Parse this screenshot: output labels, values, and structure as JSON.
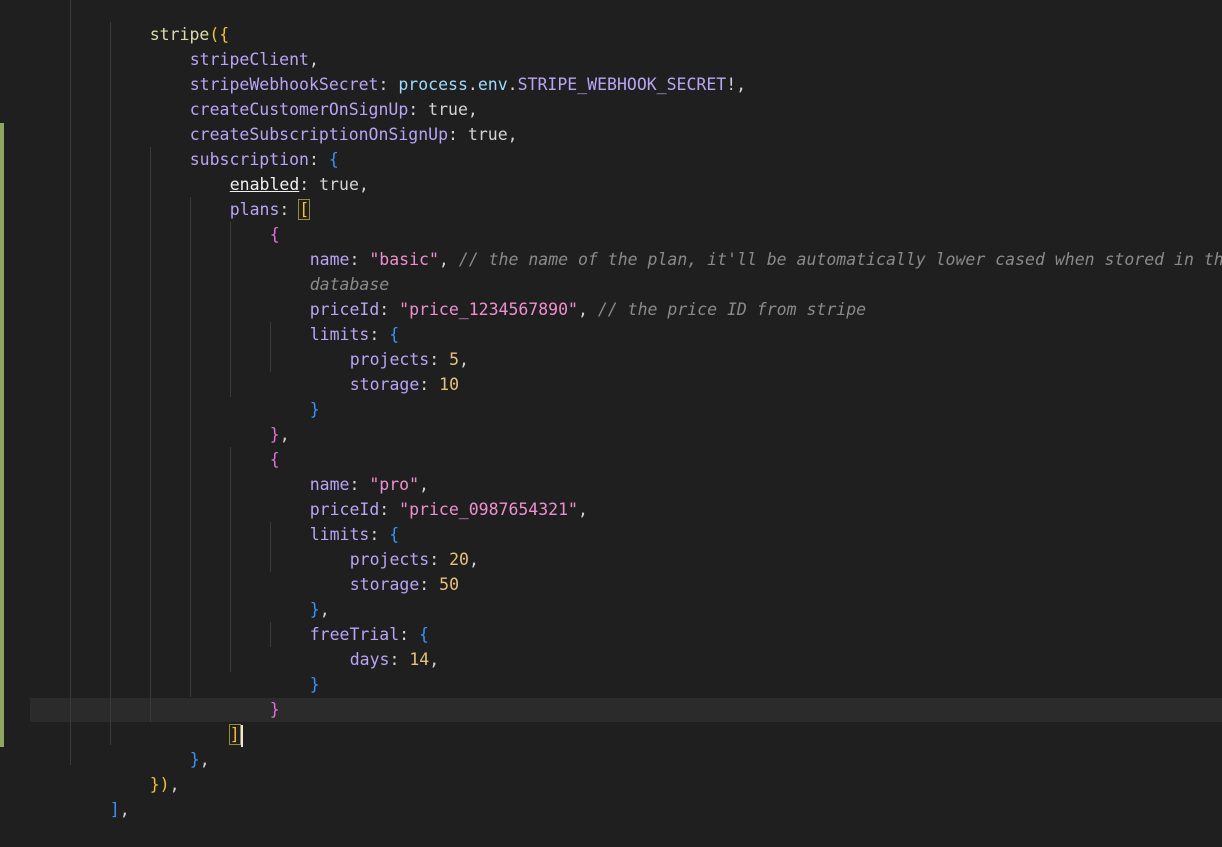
{
  "editor": {
    "lines": {
      "l1": {
        "fn": "stripe",
        "open": "({"
      },
      "l2": {
        "prop": "stripeClient",
        "tail": ","
      },
      "l3": {
        "prop": "stripeWebhookSecret",
        "colon": ": ",
        "obj": "process",
        "dot": ".",
        "env": "env",
        "dot2": ".",
        "const": "STRIPE_WEBHOOK_SECRET",
        "tail": "!,"
      },
      "l4": {
        "prop": "createCustomerOnSignUp",
        "colon": ": ",
        "val": "true",
        "tail": ","
      },
      "l5": {
        "prop": "createSubscriptionOnSignUp",
        "colon": ": ",
        "val": "true",
        "tail": ","
      },
      "l6": {
        "prop": "subscription",
        "colon": ": ",
        "open": "{"
      },
      "l7": {
        "prop": "enabled",
        "colon": ": ",
        "val": "true",
        "tail": ","
      },
      "l8": {
        "prop": "plans",
        "colon": ": ",
        "open": "["
      },
      "l9": {
        "open": "{"
      },
      "l10": {
        "prop": "name",
        "colon": ": ",
        "str": "\"basic\"",
        "tail": ", ",
        "cmt": "// the name of the plan, it'll be automatically lower cased when stored in the"
      },
      "l11": {
        "cmt": "database"
      },
      "l12": {
        "prop": "priceId",
        "colon": ": ",
        "str": "\"price_1234567890\"",
        "tail": ", ",
        "cmt": "// the price ID from stripe"
      },
      "l13": {
        "prop": "limits",
        "colon": ": ",
        "open": "{"
      },
      "l14": {
        "prop": "projects",
        "colon": ": ",
        "num": "5",
        "tail": ","
      },
      "l15": {
        "prop": "storage",
        "colon": ": ",
        "num": "10"
      },
      "l16": {
        "close": "}"
      },
      "l17": {
        "close": "}",
        "tail": ","
      },
      "l18": {
        "open": "{"
      },
      "l19": {
        "prop": "name",
        "colon": ": ",
        "str": "\"pro\"",
        "tail": ","
      },
      "l20": {
        "prop": "priceId",
        "colon": ": ",
        "str": "\"price_0987654321\"",
        "tail": ","
      },
      "l21": {
        "prop": "limits",
        "colon": ": ",
        "open": "{"
      },
      "l22": {
        "prop": "projects",
        "colon": ": ",
        "num": "20",
        "tail": ","
      },
      "l23": {
        "prop": "storage",
        "colon": ": ",
        "num": "50"
      },
      "l24": {
        "close": "}",
        "tail": ","
      },
      "l25": {
        "prop": "freeTrial",
        "colon": ": ",
        "open": "{"
      },
      "l26": {
        "prop": "days",
        "colon": ": ",
        "num": "14",
        "tail": ","
      },
      "l27": {
        "close": "}"
      },
      "l28": {
        "close": "}"
      },
      "l29": {
        "close": "]"
      },
      "l30": {
        "close": "}",
        "tail": ","
      },
      "l31": {
        "close": "})",
        "tail": ","
      },
      "l32": {
        "close": "]",
        "tail": ","
      }
    },
    "colors": {
      "background": "#1f1f1f",
      "current_line": "#2b2b2b",
      "gutter_modified": "#8ea65f"
    }
  }
}
